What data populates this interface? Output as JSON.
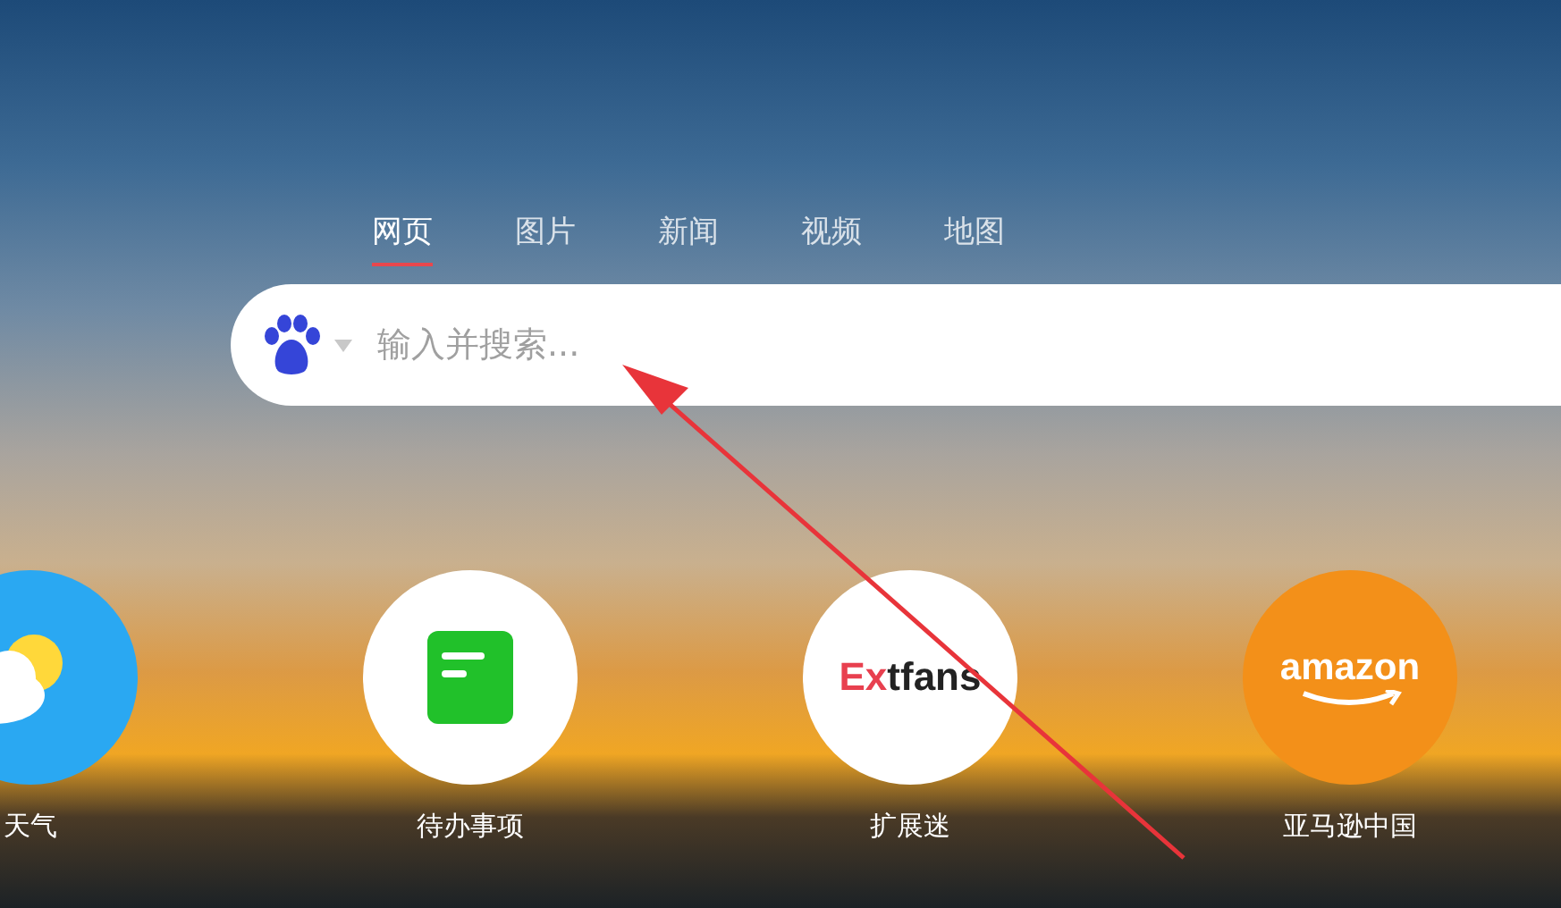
{
  "tabs": [
    {
      "label": "网页",
      "selected": true
    },
    {
      "label": "图片",
      "selected": false
    },
    {
      "label": "新闻",
      "selected": false
    },
    {
      "label": "视频",
      "selected": false
    },
    {
      "label": "地图",
      "selected": false
    }
  ],
  "search": {
    "placeholder": "输入并搜索..."
  },
  "shortcuts": [
    {
      "kind": "weather",
      "label": "天气"
    },
    {
      "kind": "todo",
      "label": "待办事项"
    },
    {
      "kind": "extfans",
      "logo_accent": "Ex",
      "logo_rest": "tfans",
      "label": "扩展迷"
    },
    {
      "kind": "amazon",
      "logo": "amazon",
      "label": "亚马逊中国"
    }
  ]
}
